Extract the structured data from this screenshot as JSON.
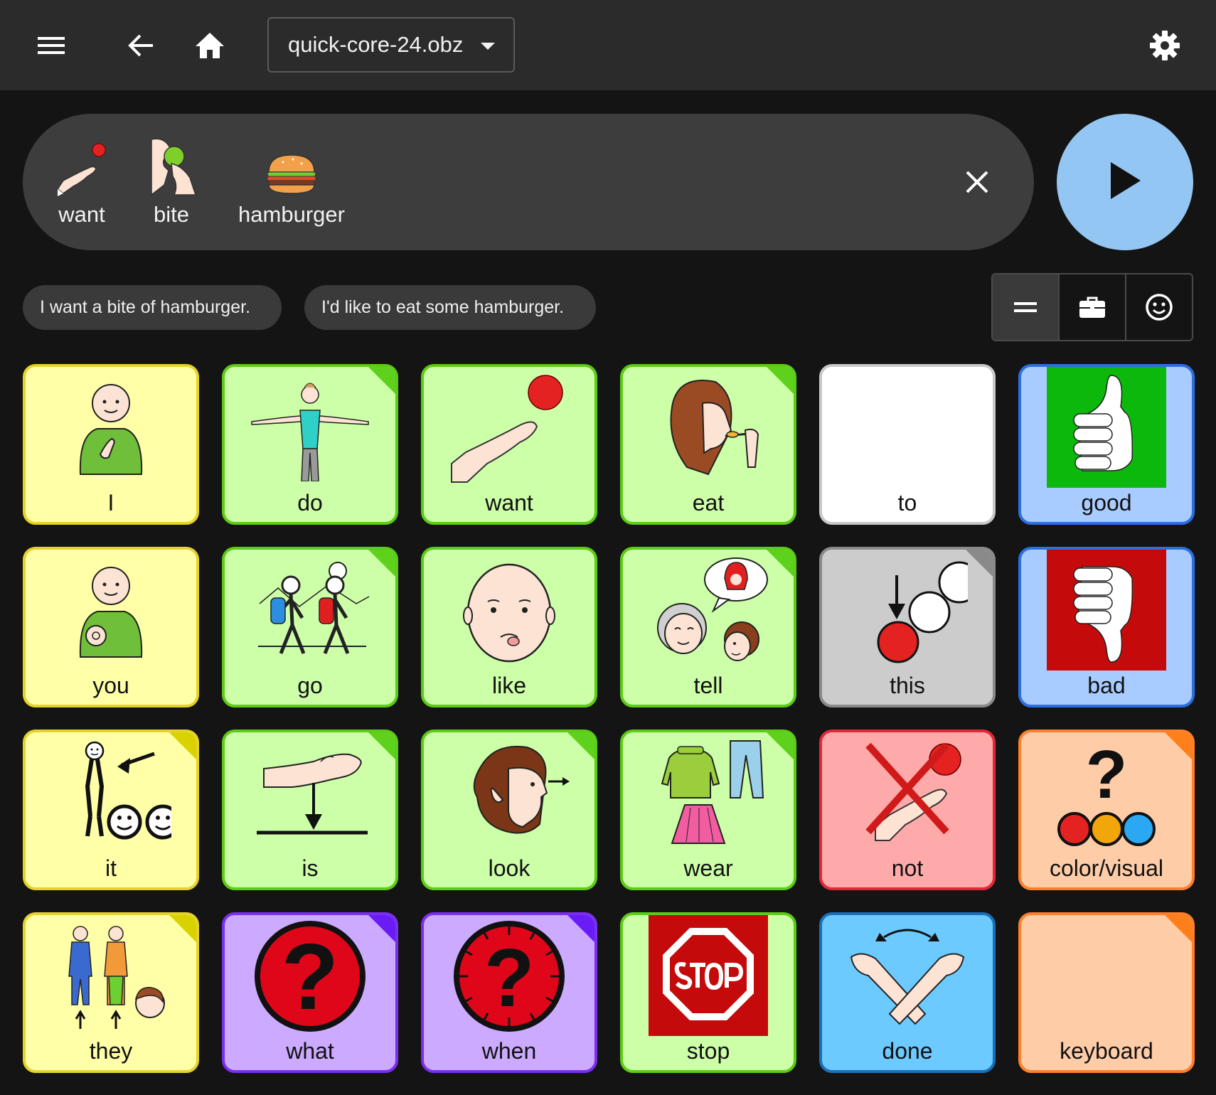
{
  "toolbar": {
    "file_name": "quick-core-24.obz",
    "icons": [
      "menu-icon",
      "back-arrow-icon",
      "home-icon",
      "dropdown-caret-icon",
      "gear-icon"
    ]
  },
  "message_bar": {
    "words": [
      {
        "label": "want",
        "icon": "hand-reaching-icon"
      },
      {
        "label": "bite",
        "icon": "biting-apple-icon"
      },
      {
        "label": "hamburger",
        "icon": "hamburger-icon"
      }
    ],
    "clear_icon": "close-icon",
    "speak_icon": "play-icon",
    "speak_color": "#93c6f3"
  },
  "suggestions": [
    "I want a bite of hamburger.",
    "I'd like to eat some hamburger."
  ],
  "view_toggle": {
    "icons": [
      "equals-icon",
      "briefcase-icon",
      "smiley-icon"
    ],
    "active": 0
  },
  "grid": {
    "rows": [
      [
        {
          "label": "I",
          "color": "yellow"
        },
        {
          "label": "do",
          "color": "green",
          "folder": true
        },
        {
          "label": "want",
          "color": "green"
        },
        {
          "label": "eat",
          "color": "green",
          "folder": true
        },
        {
          "label": "to",
          "color": "white"
        },
        {
          "label": "good",
          "color": "blue"
        }
      ],
      [
        {
          "label": "you",
          "color": "yellow"
        },
        {
          "label": "go",
          "color": "green",
          "folder": true
        },
        {
          "label": "like",
          "color": "green"
        },
        {
          "label": "tell",
          "color": "green",
          "folder": true
        },
        {
          "label": "this",
          "color": "gray",
          "folder": true
        },
        {
          "label": "bad",
          "color": "blue"
        }
      ],
      [
        {
          "label": "it",
          "color": "yellow",
          "folder": true
        },
        {
          "label": "is",
          "color": "green",
          "folder": true
        },
        {
          "label": "look",
          "color": "green",
          "folder": true
        },
        {
          "label": "wear",
          "color": "green",
          "folder": true
        },
        {
          "label": "not",
          "color": "red"
        },
        {
          "label": "color/visual",
          "color": "orange",
          "folder": true
        }
      ],
      [
        {
          "label": "they",
          "color": "yellow",
          "folder": true
        },
        {
          "label": "what",
          "color": "purple",
          "folder": true
        },
        {
          "label": "when",
          "color": "purple",
          "folder": true
        },
        {
          "label": "stop",
          "color": "green"
        },
        {
          "label": "done",
          "color": "sky"
        },
        {
          "label": "keyboard",
          "color": "orange",
          "folder": true
        }
      ]
    ],
    "fold_colors": {
      "yellow": "#d9d200",
      "green": "#5ed11c",
      "gray": "#8a8a8a",
      "orange": "#ff7f1a",
      "purple": "#6a1cf5"
    }
  }
}
